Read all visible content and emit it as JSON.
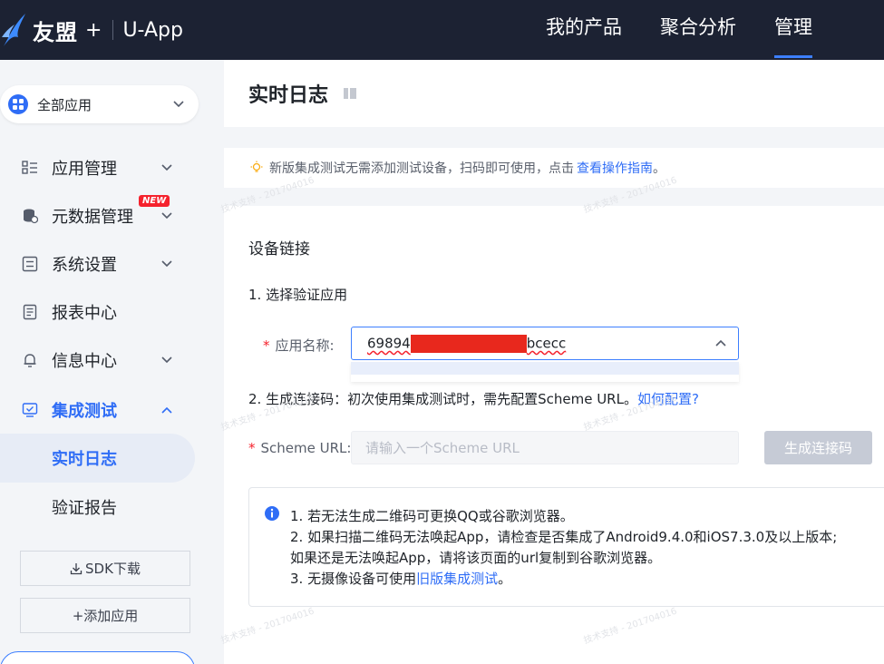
{
  "header": {
    "brand": "友盟",
    "plus": "+",
    "product": "U-App",
    "nav": [
      "我的产品",
      "聚合分析",
      "管理"
    ],
    "active_nav": "管理"
  },
  "sidebar": {
    "app_select": "全部应用",
    "menu": [
      {
        "label": "应用管理",
        "icon": "grid-list-icon",
        "chevron": "down"
      },
      {
        "label": "元数据管理",
        "icon": "database-icon",
        "chevron": "down",
        "tag": "NEW"
      },
      {
        "label": "系统设置",
        "icon": "settings-panel-icon",
        "chevron": "down"
      },
      {
        "label": "报表中心",
        "icon": "report-icon"
      },
      {
        "label": "信息中心",
        "icon": "bell-icon",
        "chevron": "down"
      },
      {
        "label": "集成测试",
        "icon": "monitor-check-icon",
        "chevron": "up"
      }
    ],
    "sub_items": [
      "实时日志",
      "验证报告"
    ],
    "sdk_button": "SDK下载",
    "add_app_button": "+添加应用"
  },
  "main": {
    "title": "实时日志",
    "notice": {
      "text": "新版集成测试无需添加测试设备，扫码即可使用，点击",
      "link": "查看操作指南",
      "suffix": "。"
    },
    "section_title": "设备链接",
    "step1": "1. 选择验证应用",
    "app_label": "应用名称:",
    "app_value_prefix": "69894",
    "app_value_suffix": "bcecc",
    "step2_text": "2. 生成连接码：初次使用集成测试时，需先配置Scheme URL。",
    "step2_link": "如何配置?",
    "scheme_label": "Scheme URL:",
    "scheme_placeholder": "请输入一个Scheme URL",
    "generate_button": "生成连接码",
    "tips": {
      "line1": "1. 若无法生成二维码可更换QQ或谷歌浏览器。",
      "line2": "2. 如果扫描二维码无法唤起App，请检查是否集成了Android9.4.0和iOS7.3.0及以上版本;",
      "line3": "如果还是无法唤起App，请将该页面的url复制到谷歌浏览器。",
      "line4_prefix": "3. 无摄像设备可使用",
      "line4_link": "旧版集成测试",
      "line4_suffix": "。"
    },
    "watermark": "技术支持 - 201704016"
  },
  "colors": {
    "topbar": "#1c2233",
    "accent": "#2f6df6",
    "required": "#f5222d",
    "new_tag": "#f5222d"
  }
}
